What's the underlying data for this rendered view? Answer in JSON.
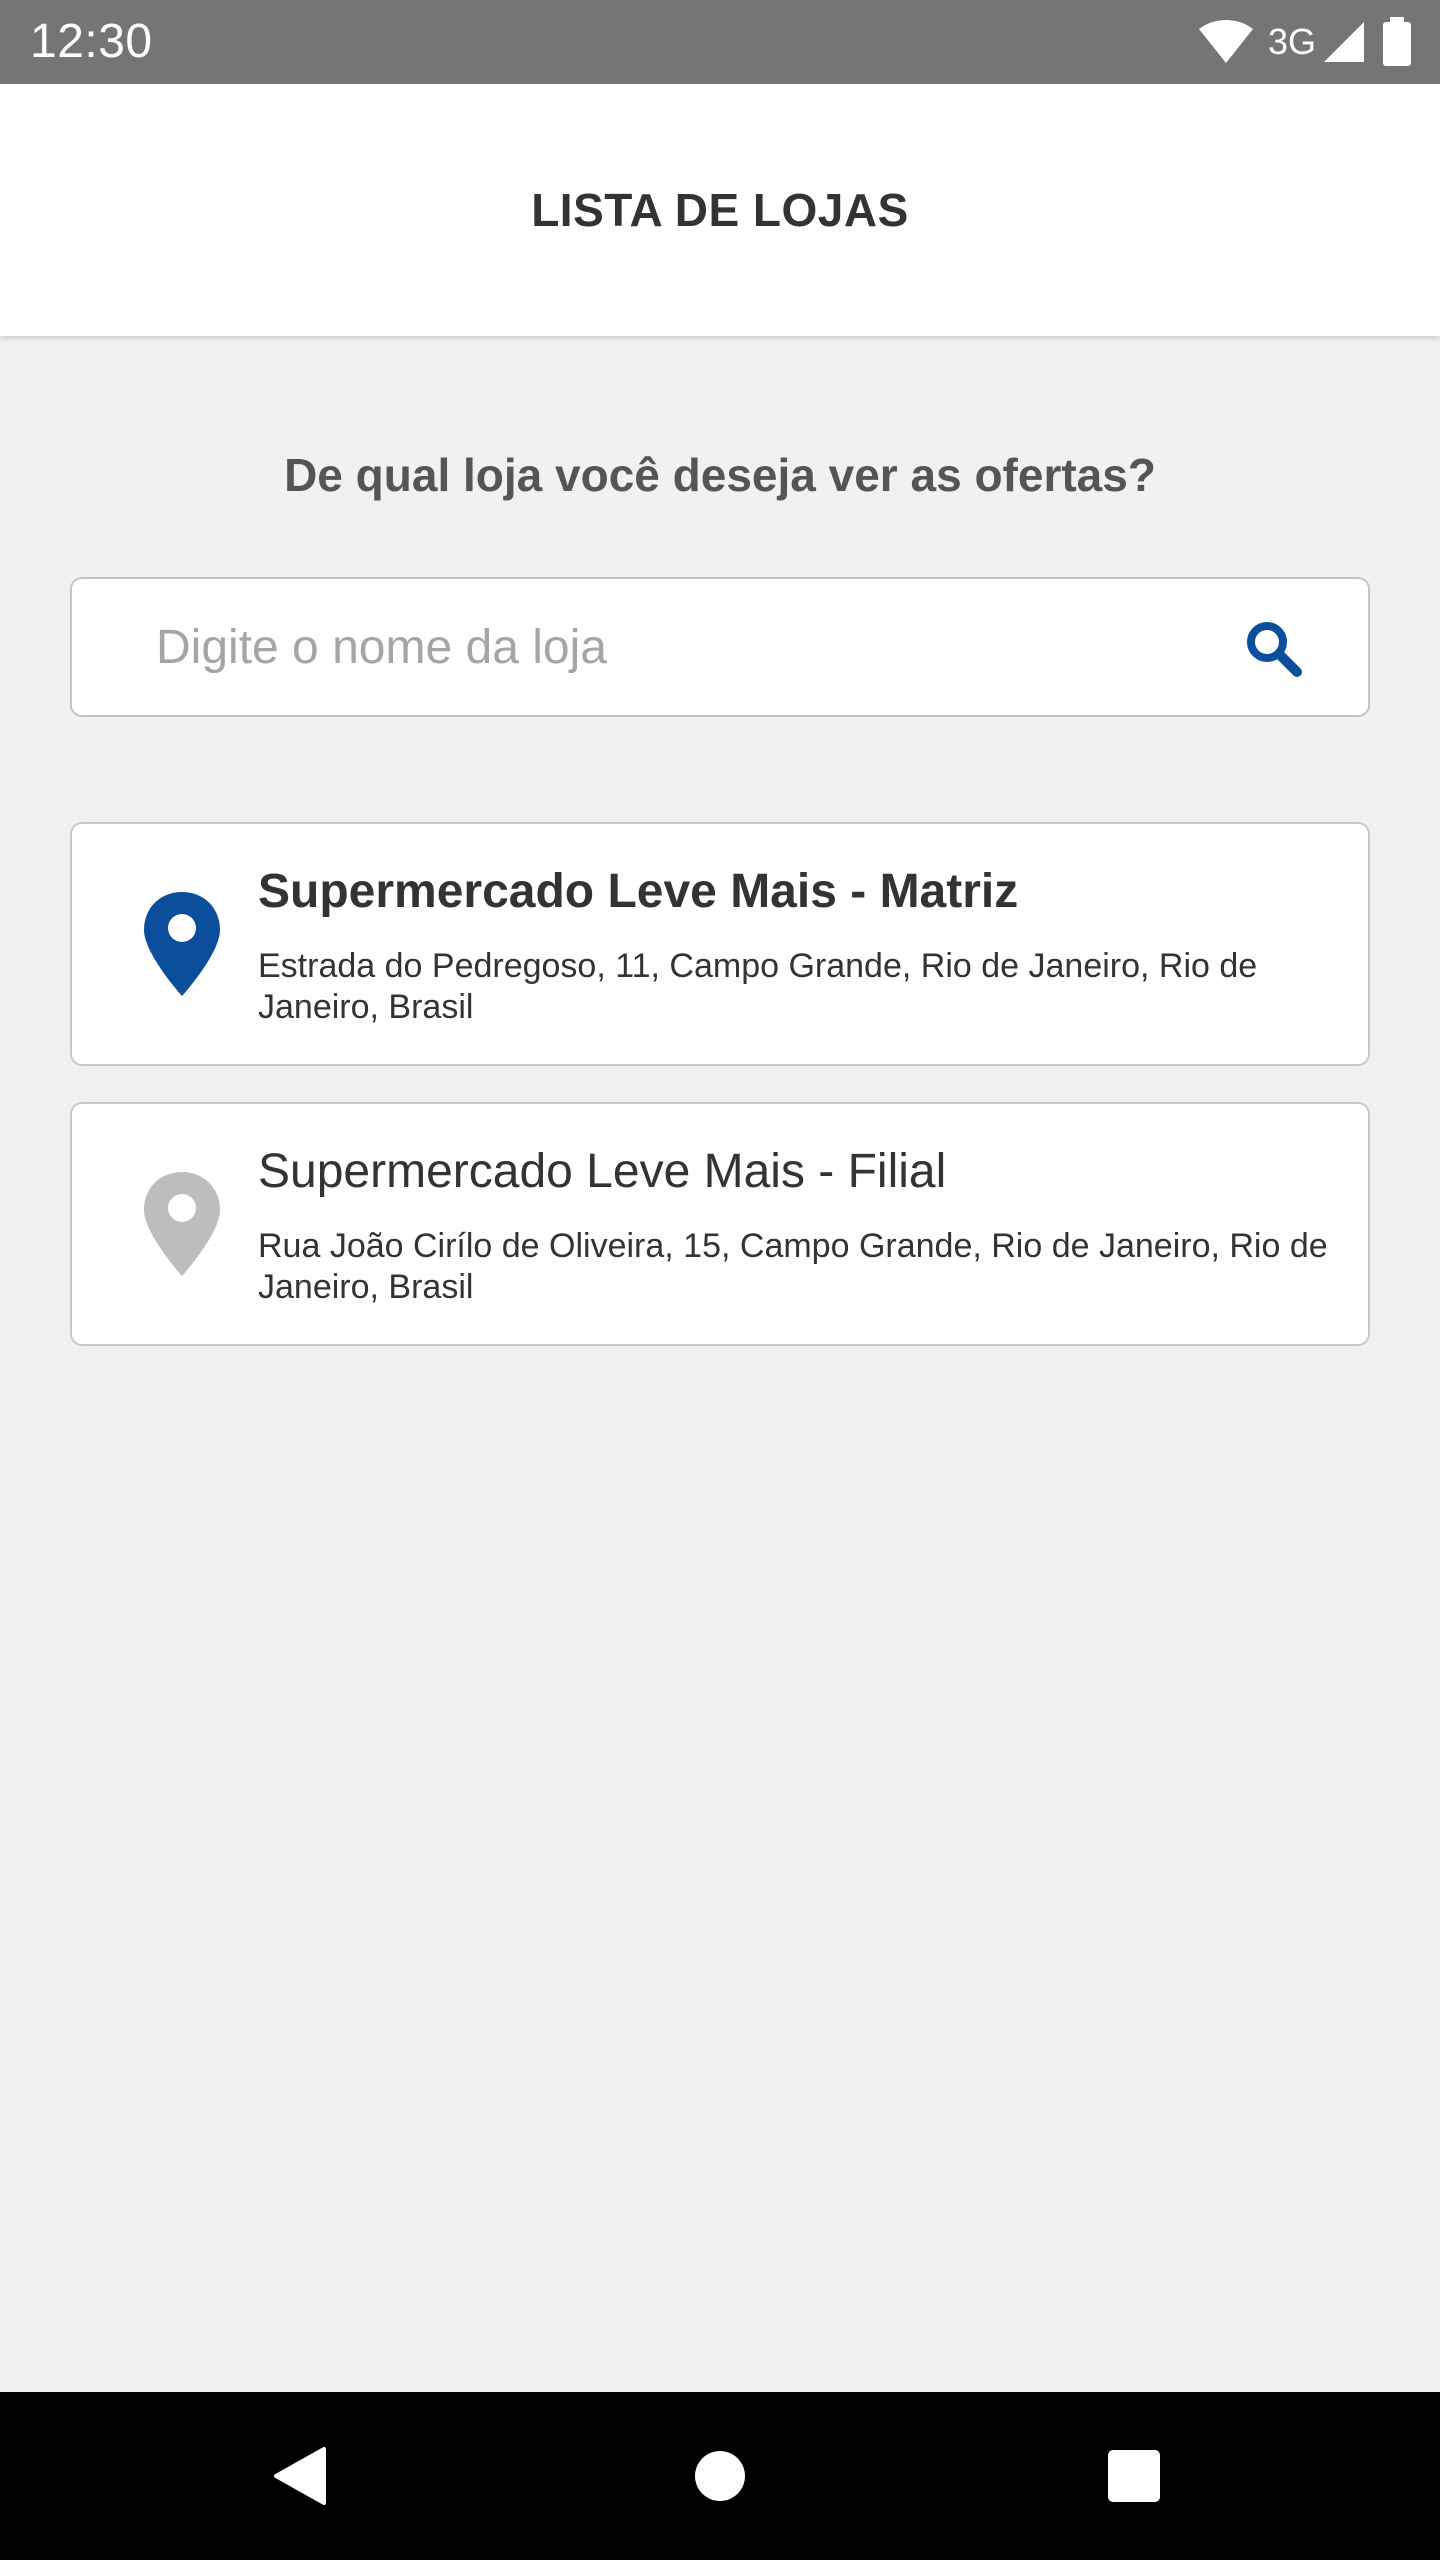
{
  "status_bar": {
    "time": "12:30",
    "network": "3G",
    "icons": [
      "wifi-icon",
      "cell-signal-icon",
      "battery-icon"
    ]
  },
  "app_bar": {
    "title": "LISTA DE LOJAS"
  },
  "main": {
    "question": "De qual loja você deseja ver as ofertas?",
    "search": {
      "placeholder": "Digite o nome da loja",
      "value": "",
      "icon": "search-icon"
    },
    "stores": [
      {
        "name": "Supermercado Leve Mais - Matriz",
        "address": "Estrada do Pedregoso, 11, Campo Grande, Rio de Janeiro, Rio de Janeiro, Brasil",
        "selected": true,
        "icon": "location-pin-icon",
        "icon_color": "#0b4f9c"
      },
      {
        "name": "Supermercado Leve Mais - Filial",
        "address": "Rua João Cirílo de Oliveira, 15, Campo Grande, Rio de Janeiro, Rio de Janeiro, Brasil",
        "selected": false,
        "icon": "location-pin-icon",
        "icon_color": "#bdbdbd"
      }
    ]
  },
  "nav_bar": {
    "buttons": [
      "back-icon",
      "home-icon",
      "recents-icon"
    ]
  },
  "colors": {
    "accent": "#0b4f9c",
    "status_bar": "#757575",
    "background": "#f1f1f1",
    "pin_inactive": "#bdbdbd"
  }
}
